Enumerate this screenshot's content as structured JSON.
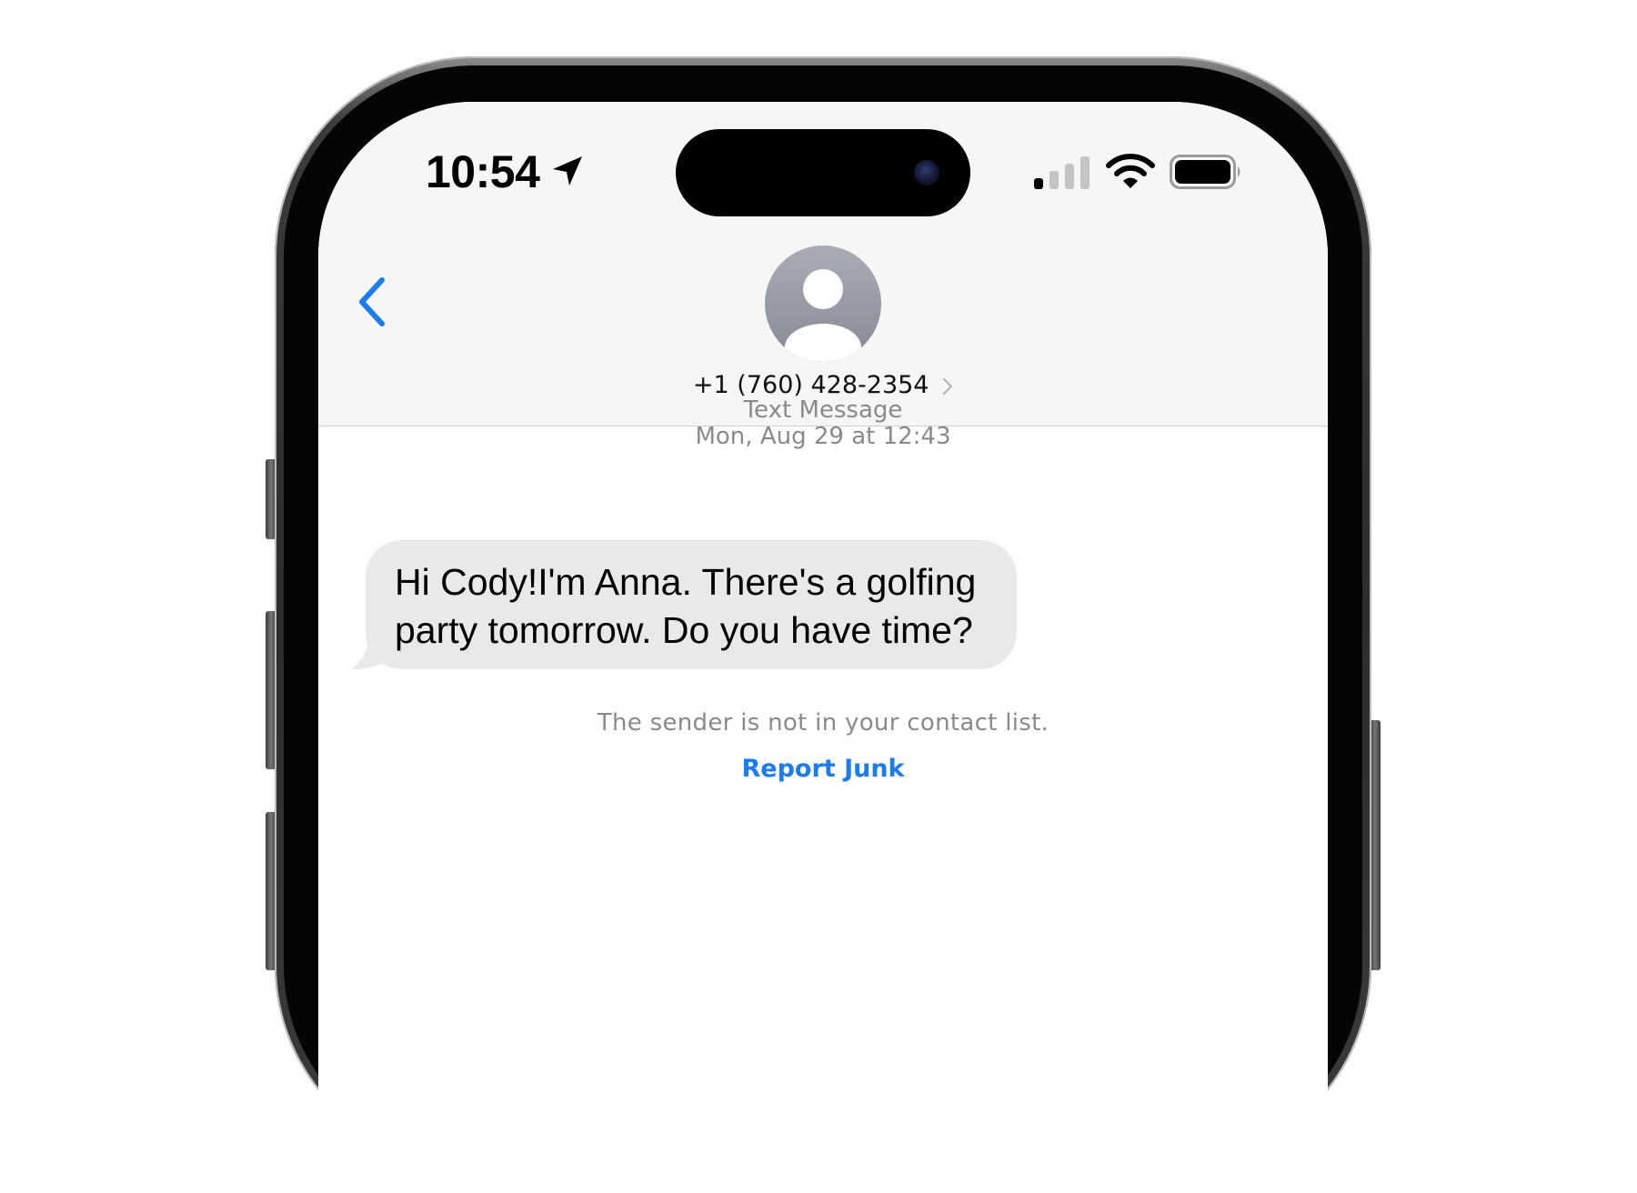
{
  "status_bar": {
    "time": "10:54",
    "location_icon": "location-arrow-icon",
    "signal_icon": "cellular-signal-icon",
    "wifi_icon": "wifi-icon",
    "battery_icon": "battery-icon"
  },
  "header": {
    "back_icon": "chevron-left-icon",
    "avatar_icon": "person-silhouette-icon",
    "contact_number": "+1 (760) 428-2354",
    "contact_chevron_icon": "chevron-right-icon"
  },
  "conversation": {
    "message_type": "Text Message",
    "timestamp": "Mon, Aug 29 at 12:43",
    "messages": [
      {
        "direction": "incoming",
        "text": "Hi Cody!I'm Anna. There's a golfing party tomorrow. Do you have time?"
      }
    ],
    "unknown_sender_note": "The sender is not in your contact list.",
    "report_junk_label": "Report Junk"
  },
  "colors": {
    "accent_blue": "#1a7cf0",
    "bubble_gray": "#e9e9eb",
    "meta_gray": "#8a8a8e",
    "header_bg": "#f6f6f6"
  }
}
